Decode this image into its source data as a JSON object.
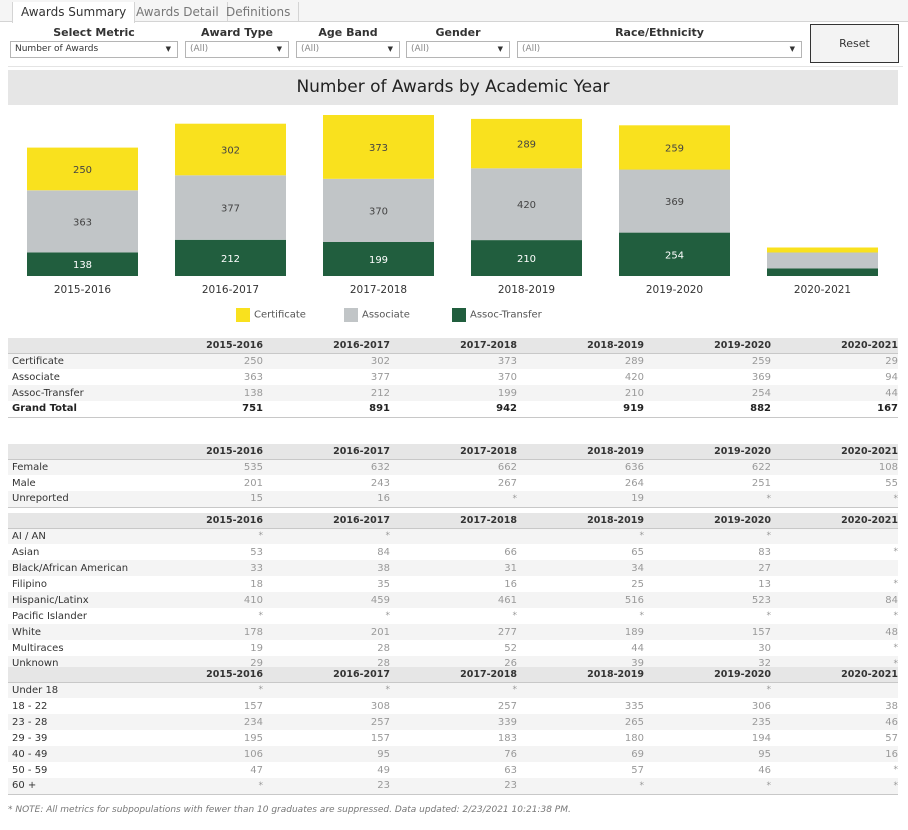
{
  "tabs": [
    {
      "label": "Awards Summary",
      "active": true
    },
    {
      "label": "Awards Detail",
      "active": false
    },
    {
      "label": "Definitions",
      "active": false
    }
  ],
  "filters": {
    "metric": {
      "label": "Select Metric",
      "value": "Number of Awards"
    },
    "award_type": {
      "label": "Award Type",
      "value": "(All)"
    },
    "age_band": {
      "label": "Age Band",
      "value": "(All)"
    },
    "gender": {
      "label": "Gender",
      "value": "(All)"
    },
    "race": {
      "label": "Race/Ethnicity",
      "value": "(All)"
    },
    "reset_label": "Reset"
  },
  "icons": {
    "dropdown_arrow": "▼"
  },
  "chart_data": {
    "type": "bar",
    "stacked": true,
    "title": "Number of Awards by Academic Year",
    "categories": [
      "2015-2016",
      "2016-2017",
      "2017-2018",
      "2018-2019",
      "2019-2020",
      "2020-2021"
    ],
    "series": [
      {
        "name": "Assoc-Transfer",
        "color": "#215E3E",
        "label_color": "#ffffff",
        "values": [
          138,
          212,
          199,
          210,
          254,
          44
        ]
      },
      {
        "name": "Associate",
        "color": "#C1C5C7",
        "label_color": "#444444",
        "values": [
          363,
          377,
          370,
          420,
          369,
          94
        ]
      },
      {
        "name": "Certificate",
        "color": "#F9E11E",
        "label_color": "#444444",
        "values": [
          250,
          302,
          373,
          289,
          259,
          29
        ]
      }
    ],
    "show_labels_for": [
      "2015-2016",
      "2016-2017",
      "2017-2018",
      "2018-2019",
      "2019-2020"
    ],
    "xlabel": "",
    "ylabel": "",
    "ylim": [
      0,
      942
    ],
    "grid": false,
    "legend": {
      "placement": "bottom",
      "order": [
        "Certificate",
        "Associate",
        "Assoc-Transfer"
      ]
    }
  },
  "tables": {
    "columns": [
      "2015-2016",
      "2016-2017",
      "2017-2018",
      "2018-2019",
      "2019-2020",
      "2020-2021"
    ],
    "award_type": [
      {
        "label": "Certificate",
        "values": [
          "250",
          "302",
          "373",
          "289",
          "259",
          "29"
        ]
      },
      {
        "label": "Associate",
        "values": [
          "363",
          "377",
          "370",
          "420",
          "369",
          "94"
        ]
      },
      {
        "label": "Assoc-Transfer",
        "values": [
          "138",
          "212",
          "199",
          "210",
          "254",
          "44"
        ]
      },
      {
        "label": "Grand Total",
        "values": [
          "751",
          "891",
          "942",
          "919",
          "882",
          "167"
        ],
        "total": true
      }
    ],
    "gender": [
      {
        "label": "Female",
        "values": [
          "535",
          "632",
          "662",
          "636",
          "622",
          "108"
        ]
      },
      {
        "label": "Male",
        "values": [
          "201",
          "243",
          "267",
          "264",
          "251",
          "55"
        ]
      },
      {
        "label": "Unreported",
        "values": [
          "15",
          "16",
          "*",
          "19",
          "*",
          "*"
        ]
      }
    ],
    "race": [
      {
        "label": "AI / AN",
        "values": [
          "*",
          "*",
          "",
          "*",
          "*",
          ""
        ]
      },
      {
        "label": "Asian",
        "values": [
          "53",
          "84",
          "66",
          "65",
          "83",
          "*"
        ]
      },
      {
        "label": "Black/African American",
        "values": [
          "33",
          "38",
          "31",
          "34",
          "27",
          ""
        ]
      },
      {
        "label": "Filipino",
        "values": [
          "18",
          "35",
          "16",
          "25",
          "13",
          "*"
        ]
      },
      {
        "label": "Hispanic/Latinx",
        "values": [
          "410",
          "459",
          "461",
          "516",
          "523",
          "84"
        ]
      },
      {
        "label": "Pacific Islander",
        "values": [
          "*",
          "*",
          "*",
          "*",
          "*",
          "*"
        ]
      },
      {
        "label": "White",
        "values": [
          "178",
          "201",
          "277",
          "189",
          "157",
          "48"
        ]
      },
      {
        "label": "Multiraces",
        "values": [
          "19",
          "28",
          "52",
          "44",
          "30",
          "*"
        ]
      },
      {
        "label": "Unknown",
        "values": [
          "29",
          "28",
          "26",
          "39",
          "32",
          "*"
        ]
      }
    ],
    "age": [
      {
        "label": "Under 18",
        "values": [
          "*",
          "*",
          "*",
          "",
          "*",
          ""
        ]
      },
      {
        "label": "18 - 22",
        "values": [
          "157",
          "308",
          "257",
          "335",
          "306",
          "38"
        ]
      },
      {
        "label": "23 - 28",
        "values": [
          "234",
          "257",
          "339",
          "265",
          "235",
          "46"
        ]
      },
      {
        "label": "29 - 39",
        "values": [
          "195",
          "157",
          "183",
          "180",
          "194",
          "57"
        ]
      },
      {
        "label": "40 - 49",
        "values": [
          "106",
          "95",
          "76",
          "69",
          "95",
          "16"
        ]
      },
      {
        "label": "50 - 59",
        "values": [
          "47",
          "49",
          "63",
          "57",
          "46",
          "*"
        ]
      },
      {
        "label": "60 +",
        "values": [
          "*",
          "23",
          "23",
          "*",
          "*",
          "*"
        ]
      }
    ]
  },
  "note": "* NOTE: All metrics for subpopulations with fewer than 10 graduates are suppressed. Data updated: 2/23/2021 10:21:38 PM."
}
